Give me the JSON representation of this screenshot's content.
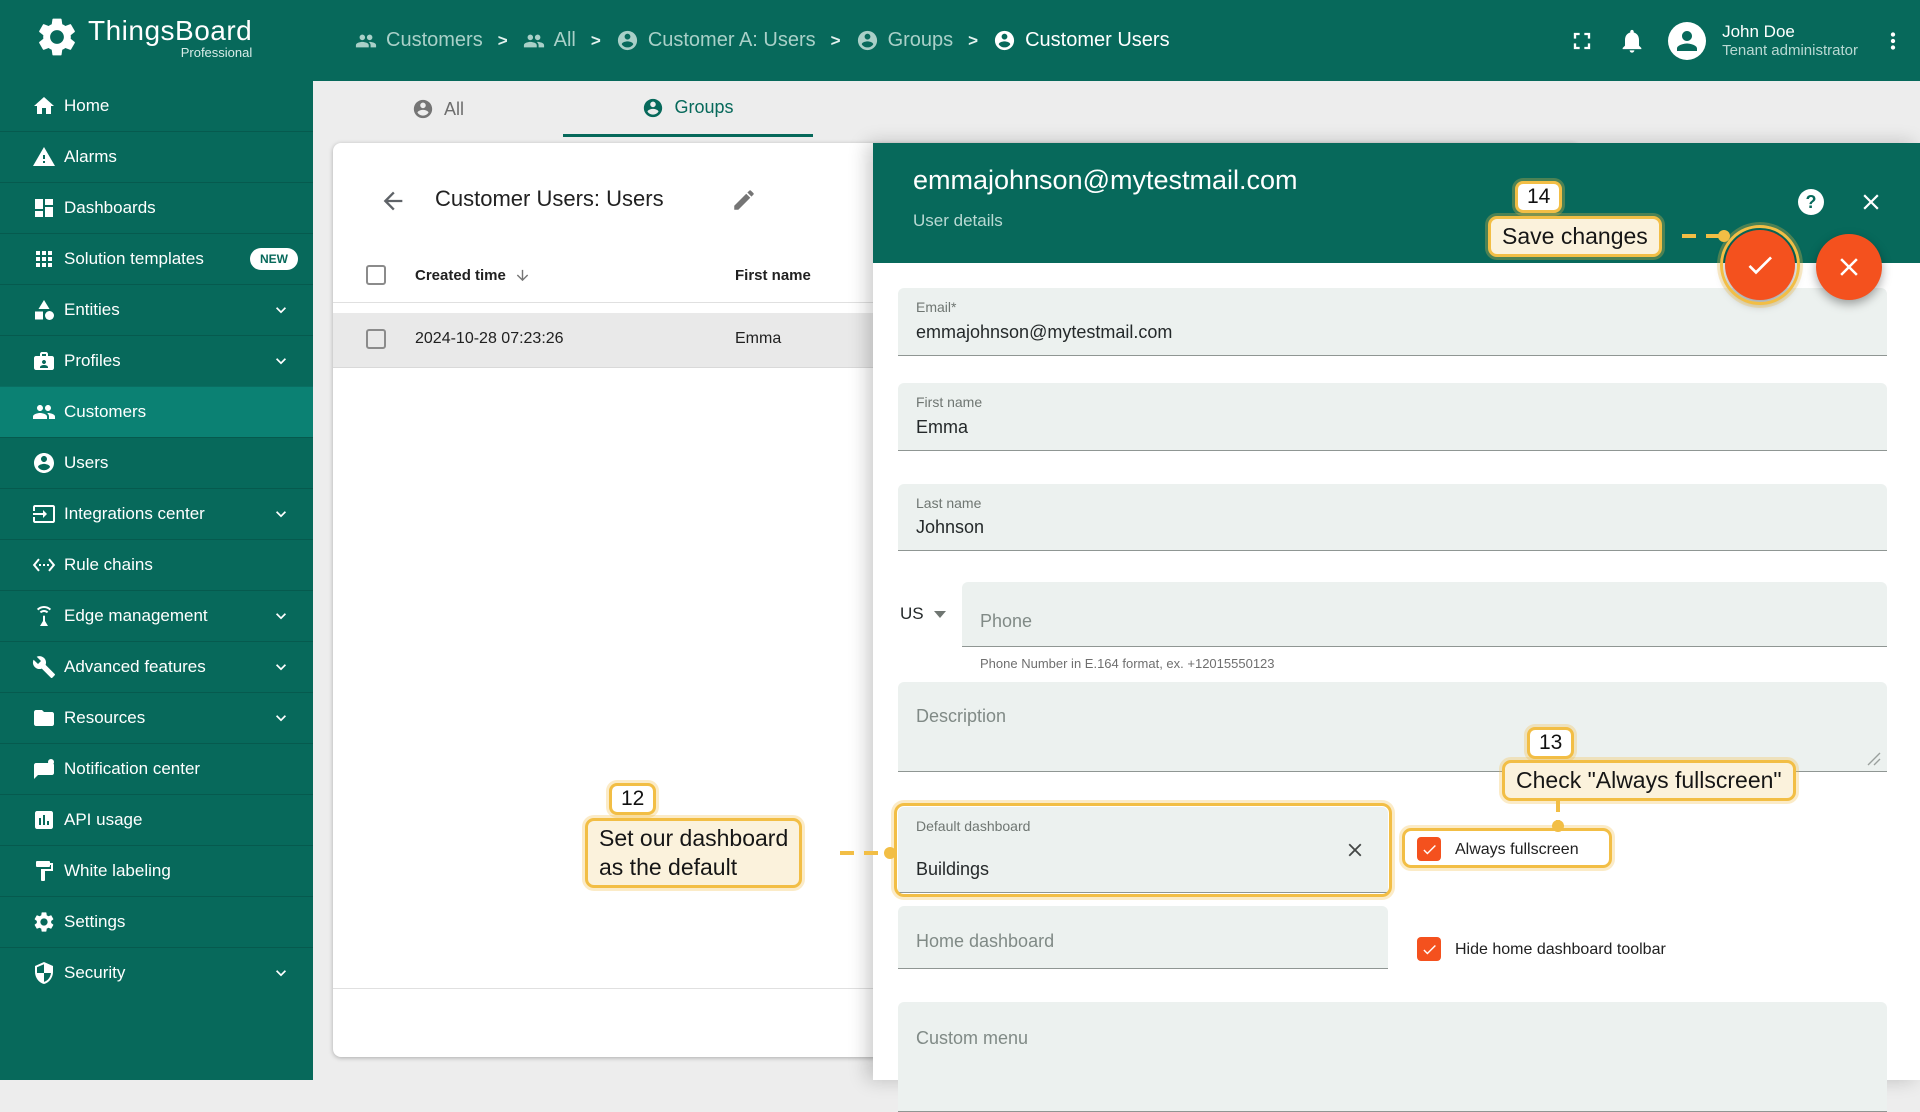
{
  "app": {
    "brand": "ThingsBoard",
    "brand_sub": "Professional"
  },
  "colors": {
    "primary_teal": "#07695B",
    "sidebar_selected": "#0B8173",
    "accent_orange": "#F4511E",
    "annotation_gold": "#F2BE45",
    "annotation_cream": "#FBF2DC",
    "field_bg": "#ECF1EF"
  },
  "sidebar": {
    "items": [
      {
        "label": "Home",
        "icon": "home-icon",
        "selected": false,
        "chevron": false
      },
      {
        "label": "Alarms",
        "icon": "alarm-warning-icon",
        "selected": false,
        "chevron": false
      },
      {
        "label": "Dashboards",
        "icon": "dashboards-icon",
        "selected": false,
        "chevron": false
      },
      {
        "label": "Solution templates",
        "icon": "solution-templates-icon",
        "selected": false,
        "chevron": false,
        "badge": "NEW"
      },
      {
        "label": "Entities",
        "icon": "entities-icon",
        "selected": false,
        "chevron": true
      },
      {
        "label": "Profiles",
        "icon": "profiles-icon",
        "selected": false,
        "chevron": true
      },
      {
        "label": "Customers",
        "icon": "customers-icon",
        "selected": true,
        "chevron": false
      },
      {
        "label": "Users",
        "icon": "users-icon",
        "selected": false,
        "chevron": false
      },
      {
        "label": "Integrations center",
        "icon": "integrations-icon",
        "selected": false,
        "chevron": true
      },
      {
        "label": "Rule chains",
        "icon": "rule-chains-icon",
        "selected": false,
        "chevron": false
      },
      {
        "label": "Edge management",
        "icon": "edge-icon",
        "selected": false,
        "chevron": true
      },
      {
        "label": "Advanced features",
        "icon": "advanced-features-icon",
        "selected": false,
        "chevron": true
      },
      {
        "label": "Resources",
        "icon": "resources-icon",
        "selected": false,
        "chevron": true
      },
      {
        "label": "Notification center",
        "icon": "notification-icon",
        "selected": false,
        "chevron": false
      },
      {
        "label": "API usage",
        "icon": "api-usage-icon",
        "selected": false,
        "chevron": false
      },
      {
        "label": "White labeling",
        "icon": "white-labeling-icon",
        "selected": false,
        "chevron": false
      },
      {
        "label": "Settings",
        "icon": "settings-icon",
        "selected": false,
        "chevron": false
      },
      {
        "label": "Security",
        "icon": "security-icon",
        "selected": false,
        "chevron": true
      }
    ]
  },
  "breadcrumb": {
    "items": [
      {
        "label": "Customers",
        "icon": "people-icon"
      },
      {
        "label": "All",
        "icon": "people-icon"
      },
      {
        "label": "Customer A: Users",
        "icon": "person-circle-icon"
      },
      {
        "label": "Groups",
        "icon": "person-circle-icon"
      },
      {
        "label": "Customer Users",
        "icon": "person-circle-icon"
      }
    ],
    "separator": ">"
  },
  "user_menu": {
    "name": "John Doe",
    "role": "Tenant administrator"
  },
  "tabs": [
    {
      "label": "All",
      "active": false
    },
    {
      "label": "Groups",
      "active": true
    }
  ],
  "table": {
    "title": "Customer Users: Users",
    "columns": [
      "Created time",
      "First name"
    ],
    "rows": [
      {
        "created_time": "2024-10-28 07:23:26",
        "first_name": "Emma",
        "selected": true
      }
    ]
  },
  "details": {
    "title": "emmajohnson@mytestmail.com",
    "subtitle": "User details",
    "fields": {
      "email": {
        "label": "Email*",
        "value": "emmajohnson@mytestmail.com"
      },
      "first_name": {
        "label": "First name",
        "value": "Emma"
      },
      "last_name": {
        "label": "Last name",
        "value": "Johnson"
      },
      "phone": {
        "country": "US",
        "placeholder": "Phone",
        "hint": "Phone Number in E.164 format, ex. +12015550123"
      },
      "description": {
        "label": "Description"
      },
      "default_dashboard": {
        "label": "Default dashboard",
        "value": "Buildings"
      },
      "always_fullscreen": {
        "label": "Always fullscreen",
        "checked": true
      },
      "home_dashboard": {
        "placeholder": "Home dashboard"
      },
      "hide_home_toolbar": {
        "label": "Hide home dashboard toolbar",
        "checked": true
      },
      "custom_menu": {
        "label": "Custom menu"
      }
    }
  },
  "annotations": {
    "a12": {
      "number": "12",
      "line1": "Set our dashboard",
      "line2": "as the default"
    },
    "a13": {
      "number": "13",
      "text": "Check \"Always fullscreen\""
    },
    "a14": {
      "number": "14",
      "text": "Save changes"
    }
  }
}
